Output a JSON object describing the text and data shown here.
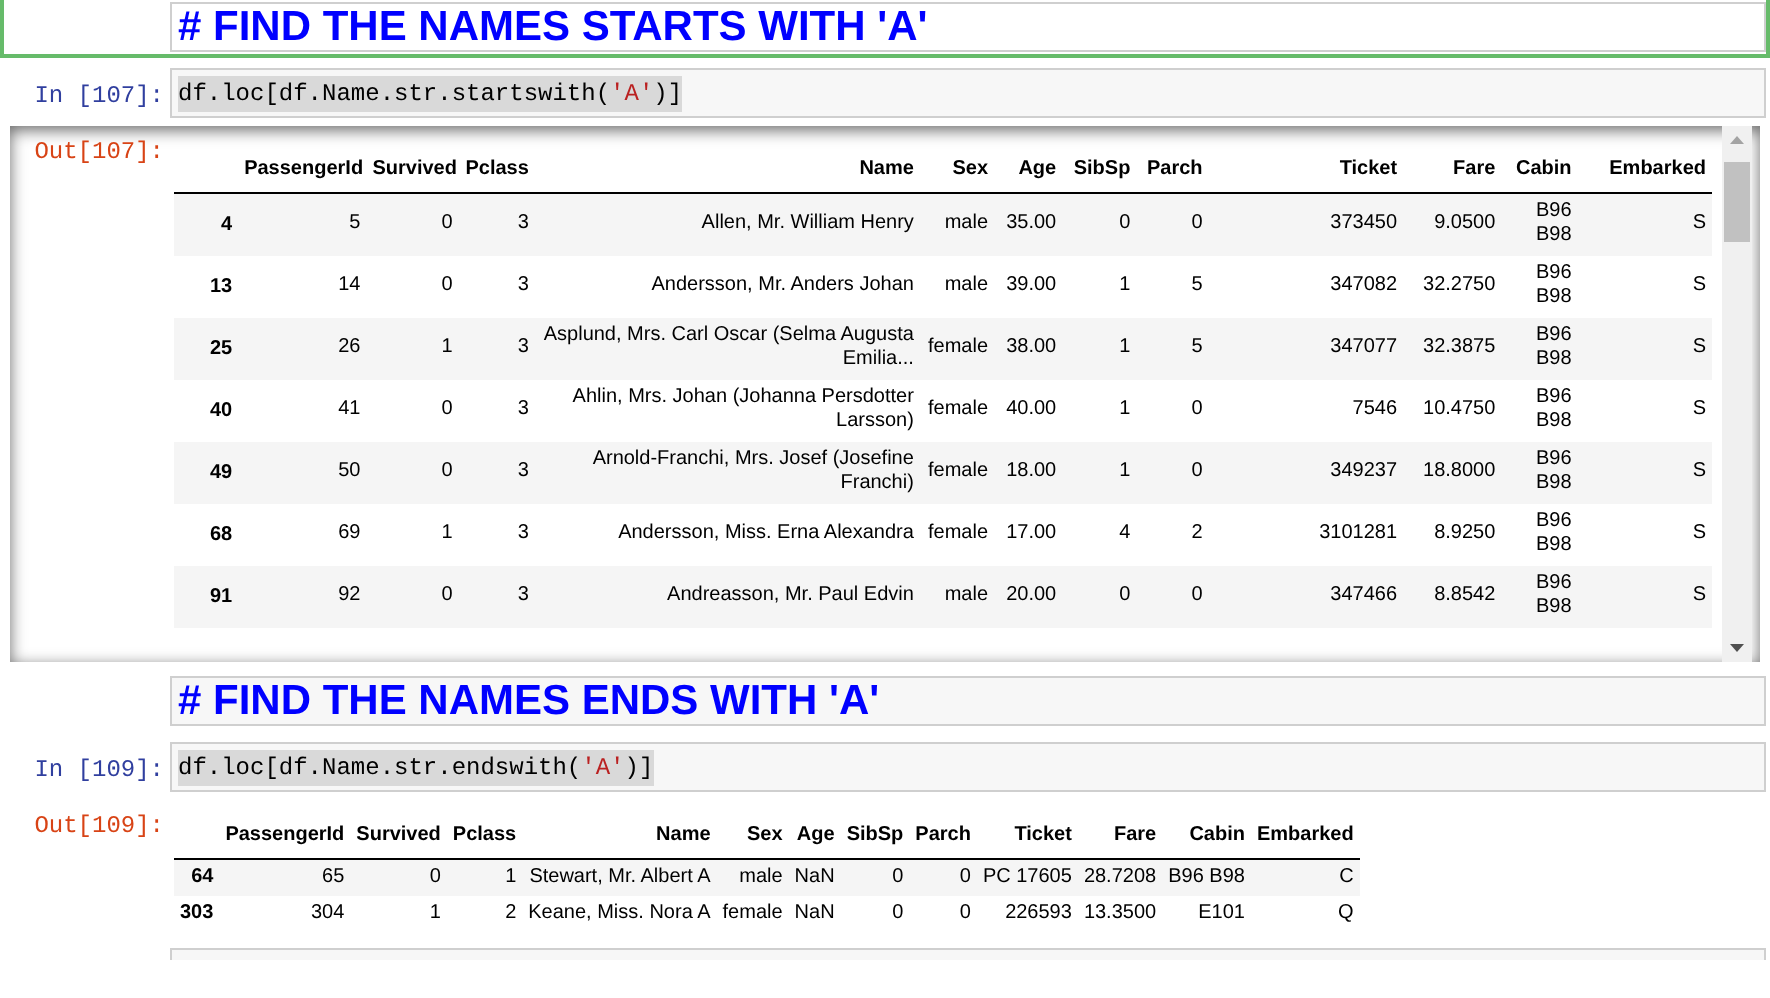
{
  "cells": [
    {
      "kind": "markdown",
      "selected": true,
      "text": "# FIND THE NAMES STARTS WITH 'A'"
    },
    {
      "kind": "code",
      "selected": false,
      "prompt": "In [107]:",
      "highlighted": true,
      "code": [
        {
          "kind": "plain",
          "text": "df.loc[df.Name.str.startswith("
        },
        {
          "kind": "string",
          "text": "'A'"
        },
        {
          "kind": "plain",
          "text": ")]"
        }
      ],
      "output": {
        "prompt": "Out[107]:",
        "scrolled": true,
        "table": {
          "columns": [
            "PassengerId",
            "Survived",
            "Pclass",
            "Name",
            "Sex",
            "Age",
            "SibSp",
            "Parch",
            "Ticket",
            "Fare",
            "Cabin",
            "Embarked"
          ],
          "rows": [
            {
              "index": "4",
              "cells": [
                "5",
                "0",
                "3",
                "Allen, Mr. William Henry",
                "male",
                "35.00",
                "0",
                "0",
                "373450",
                "9.0500",
                "B96 B98",
                "S"
              ]
            },
            {
              "index": "13",
              "cells": [
                "14",
                "0",
                "3",
                "Andersson, Mr. Anders Johan",
                "male",
                "39.00",
                "1",
                "5",
                "347082",
                "32.2750",
                "B96 B98",
                "S"
              ]
            },
            {
              "index": "25",
              "cells": [
                "26",
                "1",
                "3",
                "Asplund, Mrs. Carl Oscar (Selma Augusta Emilia...",
                "female",
                "38.00",
                "1",
                "5",
                "347077",
                "32.3875",
                "B96 B98",
                "S"
              ]
            },
            {
              "index": "40",
              "cells": [
                "41",
                "0",
                "3",
                "Ahlin, Mrs. Johan (Johanna Persdotter Larsson)",
                "female",
                "40.00",
                "1",
                "0",
                "7546",
                "10.4750",
                "B96 B98",
                "S"
              ]
            },
            {
              "index": "49",
              "cells": [
                "50",
                "0",
                "3",
                "Arnold-Franchi, Mrs. Josef (Josefine Franchi)",
                "female",
                "18.00",
                "1",
                "0",
                "349237",
                "18.8000",
                "B96 B98",
                "S"
              ]
            },
            {
              "index": "68",
              "cells": [
                "69",
                "1",
                "3",
                "Andersson, Miss. Erna Alexandra",
                "female",
                "17.00",
                "4",
                "2",
                "3101281",
                "8.9250",
                "B96 B98",
                "S"
              ]
            },
            {
              "index": "91",
              "cells": [
                "92",
                "0",
                "3",
                "Andreasson, Mr. Paul Edvin",
                "male",
                "20.00",
                "0",
                "0",
                "347466",
                "8.8542",
                "B96 B98",
                "S"
              ]
            }
          ]
        }
      }
    },
    {
      "kind": "markdown",
      "selected": false,
      "text": "# FIND THE NAMES ENDS WITH 'A'"
    },
    {
      "kind": "code",
      "selected": false,
      "prompt": "In [109]:",
      "highlighted": true,
      "code": [
        {
          "kind": "plain",
          "text": "df.loc[df.Name.str.endswith("
        },
        {
          "kind": "string",
          "text": "'A'"
        },
        {
          "kind": "plain",
          "text": ")]"
        }
      ],
      "output": {
        "prompt": "Out[109]:",
        "scrolled": false,
        "table": {
          "columns": [
            "PassengerId",
            "Survived",
            "Pclass",
            "Name",
            "Sex",
            "Age",
            "SibSp",
            "Parch",
            "Ticket",
            "Fare",
            "Cabin",
            "Embarked"
          ],
          "rows": [
            {
              "index": "64",
              "cells": [
                "65",
                "0",
                "1",
                "Stewart, Mr. Albert A",
                "male",
                "NaN",
                "0",
                "0",
                "PC 17605",
                "28.7208",
                "B96 B98",
                "C"
              ]
            },
            {
              "index": "303",
              "cells": [
                "304",
                "1",
                "2",
                "Keane, Miss. Nora A",
                "female",
                "NaN",
                "0",
                "0",
                "226593",
                "13.3500",
                "E101",
                "Q"
              ]
            }
          ]
        }
      }
    },
    {
      "kind": "empty",
      "selected": false
    }
  ]
}
